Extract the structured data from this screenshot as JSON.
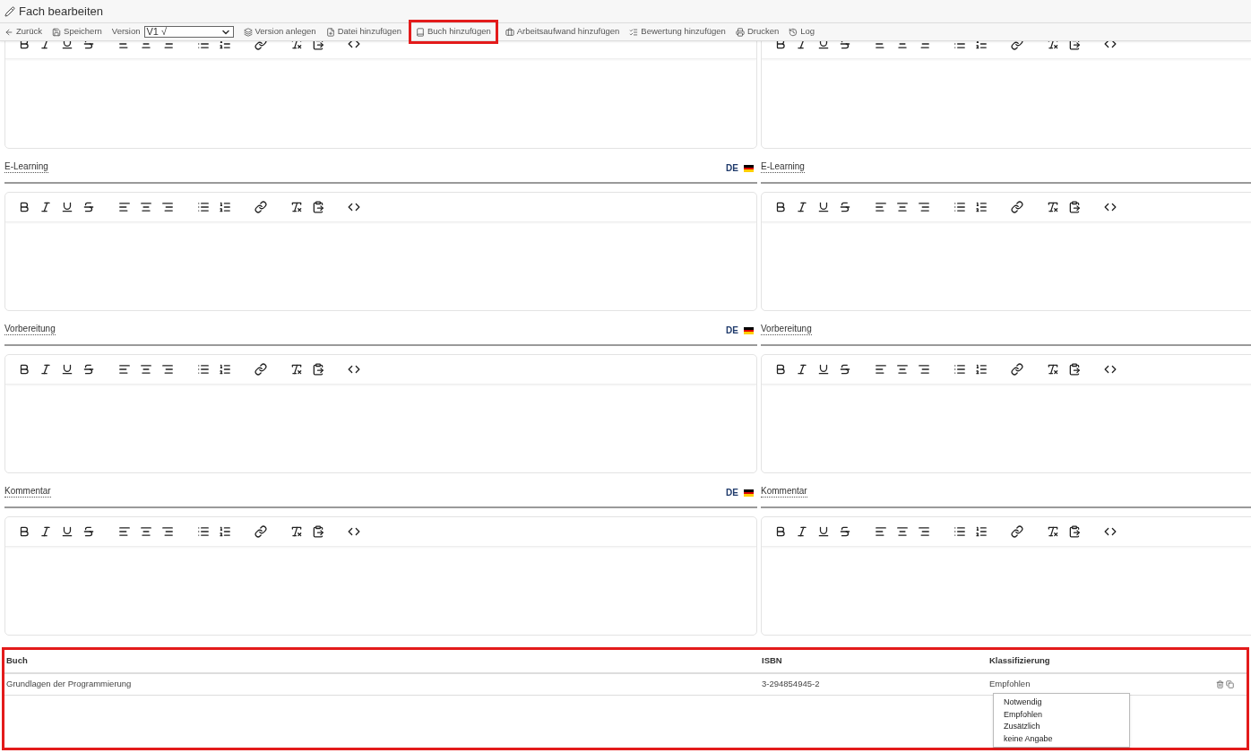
{
  "page": {
    "title": "Fach bearbeiten"
  },
  "toolbar": [
    {
      "kind": "back",
      "label": "Zurück"
    },
    {
      "kind": "save",
      "label": "Speichern"
    },
    {
      "kind": "select",
      "label": "Version",
      "value": "V1 √"
    },
    {
      "kind": "version",
      "label": "Version anlegen"
    },
    {
      "kind": "file",
      "label": "Datei hinzufügen"
    },
    {
      "kind": "book",
      "label": "Buch hinzufügen",
      "highlighted": true
    },
    {
      "kind": "workload",
      "label": "Arbeitsaufwand hinzufügen"
    },
    {
      "kind": "rating",
      "label": "Bewertung hinzufügen"
    },
    {
      "kind": "print",
      "label": "Drucken"
    },
    {
      "kind": "log",
      "label": "Log"
    }
  ],
  "sections": [
    {
      "scrolled": true
    },
    {
      "label_left": "E-Learning",
      "language": "DE",
      "label_right": "E-Learning"
    },
    {
      "label_left": "Vorbereitung",
      "language": "DE",
      "label_right": "Vorbereitung"
    },
    {
      "label_left": "Kommentar",
      "language": "DE",
      "label_right": "Kommentar"
    }
  ],
  "books": {
    "highlighted": true,
    "columns": [
      "Buch",
      "ISBN",
      "Klassifizierung"
    ],
    "rows": [
      {
        "title": "Grundlagen der Programmierung",
        "isbn": "3-294854945-2",
        "classification": "Empfohlen"
      }
    ],
    "dropdown": {
      "options": [
        "Notwendig",
        "Empfohlen",
        "Zusätzlich",
        "keine Angabe"
      ]
    }
  }
}
